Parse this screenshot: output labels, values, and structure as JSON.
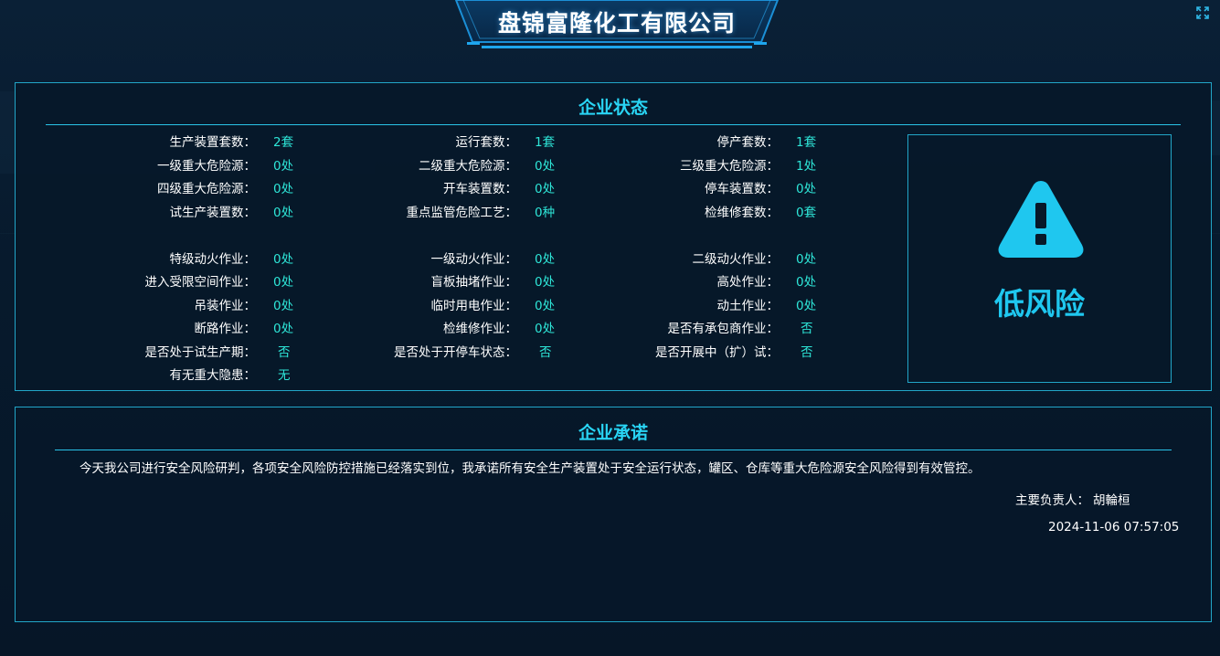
{
  "header": {
    "title": "盘锦富隆化工有限公司",
    "fullscreen_icon": "fullscreen-icon"
  },
  "status": {
    "title": "企业状态",
    "rows": [
      [
        {
          "label": "生产装置套数：",
          "value": "2套"
        },
        {
          "label": "运行套数：",
          "value": "1套"
        },
        {
          "label": "停产套数：",
          "value": "1套"
        }
      ],
      [
        {
          "label": "一级重大危险源：",
          "value": "0处"
        },
        {
          "label": "二级重大危险源：",
          "value": "0处"
        },
        {
          "label": "三级重大危险源：",
          "value": "1处"
        }
      ],
      [
        {
          "label": "四级重大危险源：",
          "value": "0处"
        },
        {
          "label": "开车装置数：",
          "value": "0处"
        },
        {
          "label": "停车装置数：",
          "value": "0处"
        }
      ],
      [
        {
          "label": "试生产装置数：",
          "value": "0处"
        },
        {
          "label": "重点监管危险工艺：",
          "value": "0种"
        },
        {
          "label": "检维修套数：",
          "value": "0套"
        }
      ],
      [
        {
          "label": "特级动火作业：",
          "value": "0处"
        },
        {
          "label": "一级动火作业：",
          "value": "0处"
        },
        {
          "label": "二级动火作业：",
          "value": "0处"
        }
      ],
      [
        {
          "label": "进入受限空间作业：",
          "value": "0处"
        },
        {
          "label": "盲板抽堵作业：",
          "value": "0处"
        },
        {
          "label": "高处作业：",
          "value": "0处"
        }
      ],
      [
        {
          "label": "吊装作业：",
          "value": "0处"
        },
        {
          "label": "临时用电作业：",
          "value": "0处"
        },
        {
          "label": "动土作业：",
          "value": "0处"
        }
      ],
      [
        {
          "label": "断路作业：",
          "value": "0处"
        },
        {
          "label": "检维修作业：",
          "value": "0处"
        },
        {
          "label": "是否有承包商作业：",
          "value": "否"
        }
      ],
      [
        {
          "label": "是否处于试生产期：",
          "value": "否"
        },
        {
          "label": "是否处于开停车状态：",
          "value": "否"
        },
        {
          "label": "是否开展中（扩）试：",
          "value": "否"
        }
      ],
      [
        {
          "label": "有无重大隐患：",
          "value": "无"
        }
      ]
    ],
    "risk": {
      "icon": "warning-icon",
      "level": "低风险",
      "color": "#1fc7ef"
    }
  },
  "promise": {
    "title": "企业承诺",
    "text": "今天我公司进行安全风险研判，各项安全风险防控措施已经落实到位，我承诺所有安全生产装置处于安全运行状态，罐区、仓库等重大危险源安全风险得到有效管控。",
    "owner_label": "主要负责人：",
    "owner_name": "胡輪桓",
    "timestamp": "2024-11-06 07:57:05"
  },
  "colors": {
    "accent": "#29d5f5",
    "value": "#2ee6d8",
    "border": "#22a6c8"
  }
}
